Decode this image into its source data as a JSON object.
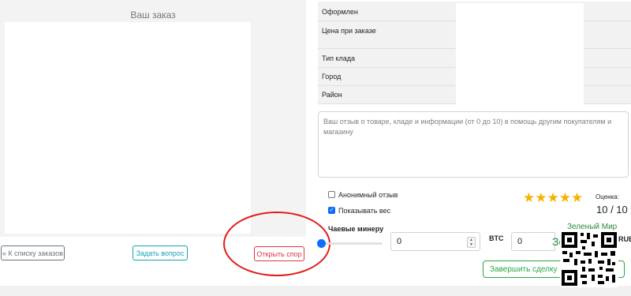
{
  "order": {
    "title": "Ваш заказ"
  },
  "buttons": {
    "back": "« К списку заказов",
    "ask": "Задать вопрос",
    "dispute": "Открыть спор",
    "finish": "Завершить сделку"
  },
  "info": {
    "rows": [
      {
        "label": "Оформлен"
      },
      {
        "label": "Цена при заказе"
      },
      {
        "label": "Тип клада"
      },
      {
        "label": "Город"
      },
      {
        "label": "Район"
      }
    ]
  },
  "review": {
    "placeholder": "Ваш отзыв о товаре, кладе и информации (от 0 до 10) в помощь другим покупателям и магазину",
    "anonymous_label": "Анонимный отзыв",
    "anonymous_checked": false,
    "show_weight_label": "Показывать вес",
    "show_weight_checked": true
  },
  "rating": {
    "label": "Оценка:",
    "value": "10 / 10",
    "stars": 5
  },
  "tips": {
    "label": "Чаевые минеру",
    "btc_value": "0",
    "btc_label": "BTC",
    "rub_value": "0",
    "rub_label": "RUB",
    "slider_fraction": 0
  },
  "watermark": {
    "text": "Зеленый Мир",
    "big": "Зел"
  },
  "colors": {
    "accent_blue": "#0d6efd",
    "danger": "#dc3545",
    "info": "#17a2b8",
    "success": "#28a745",
    "star": "#f5b301",
    "annotation_red": "#e21b1b"
  }
}
